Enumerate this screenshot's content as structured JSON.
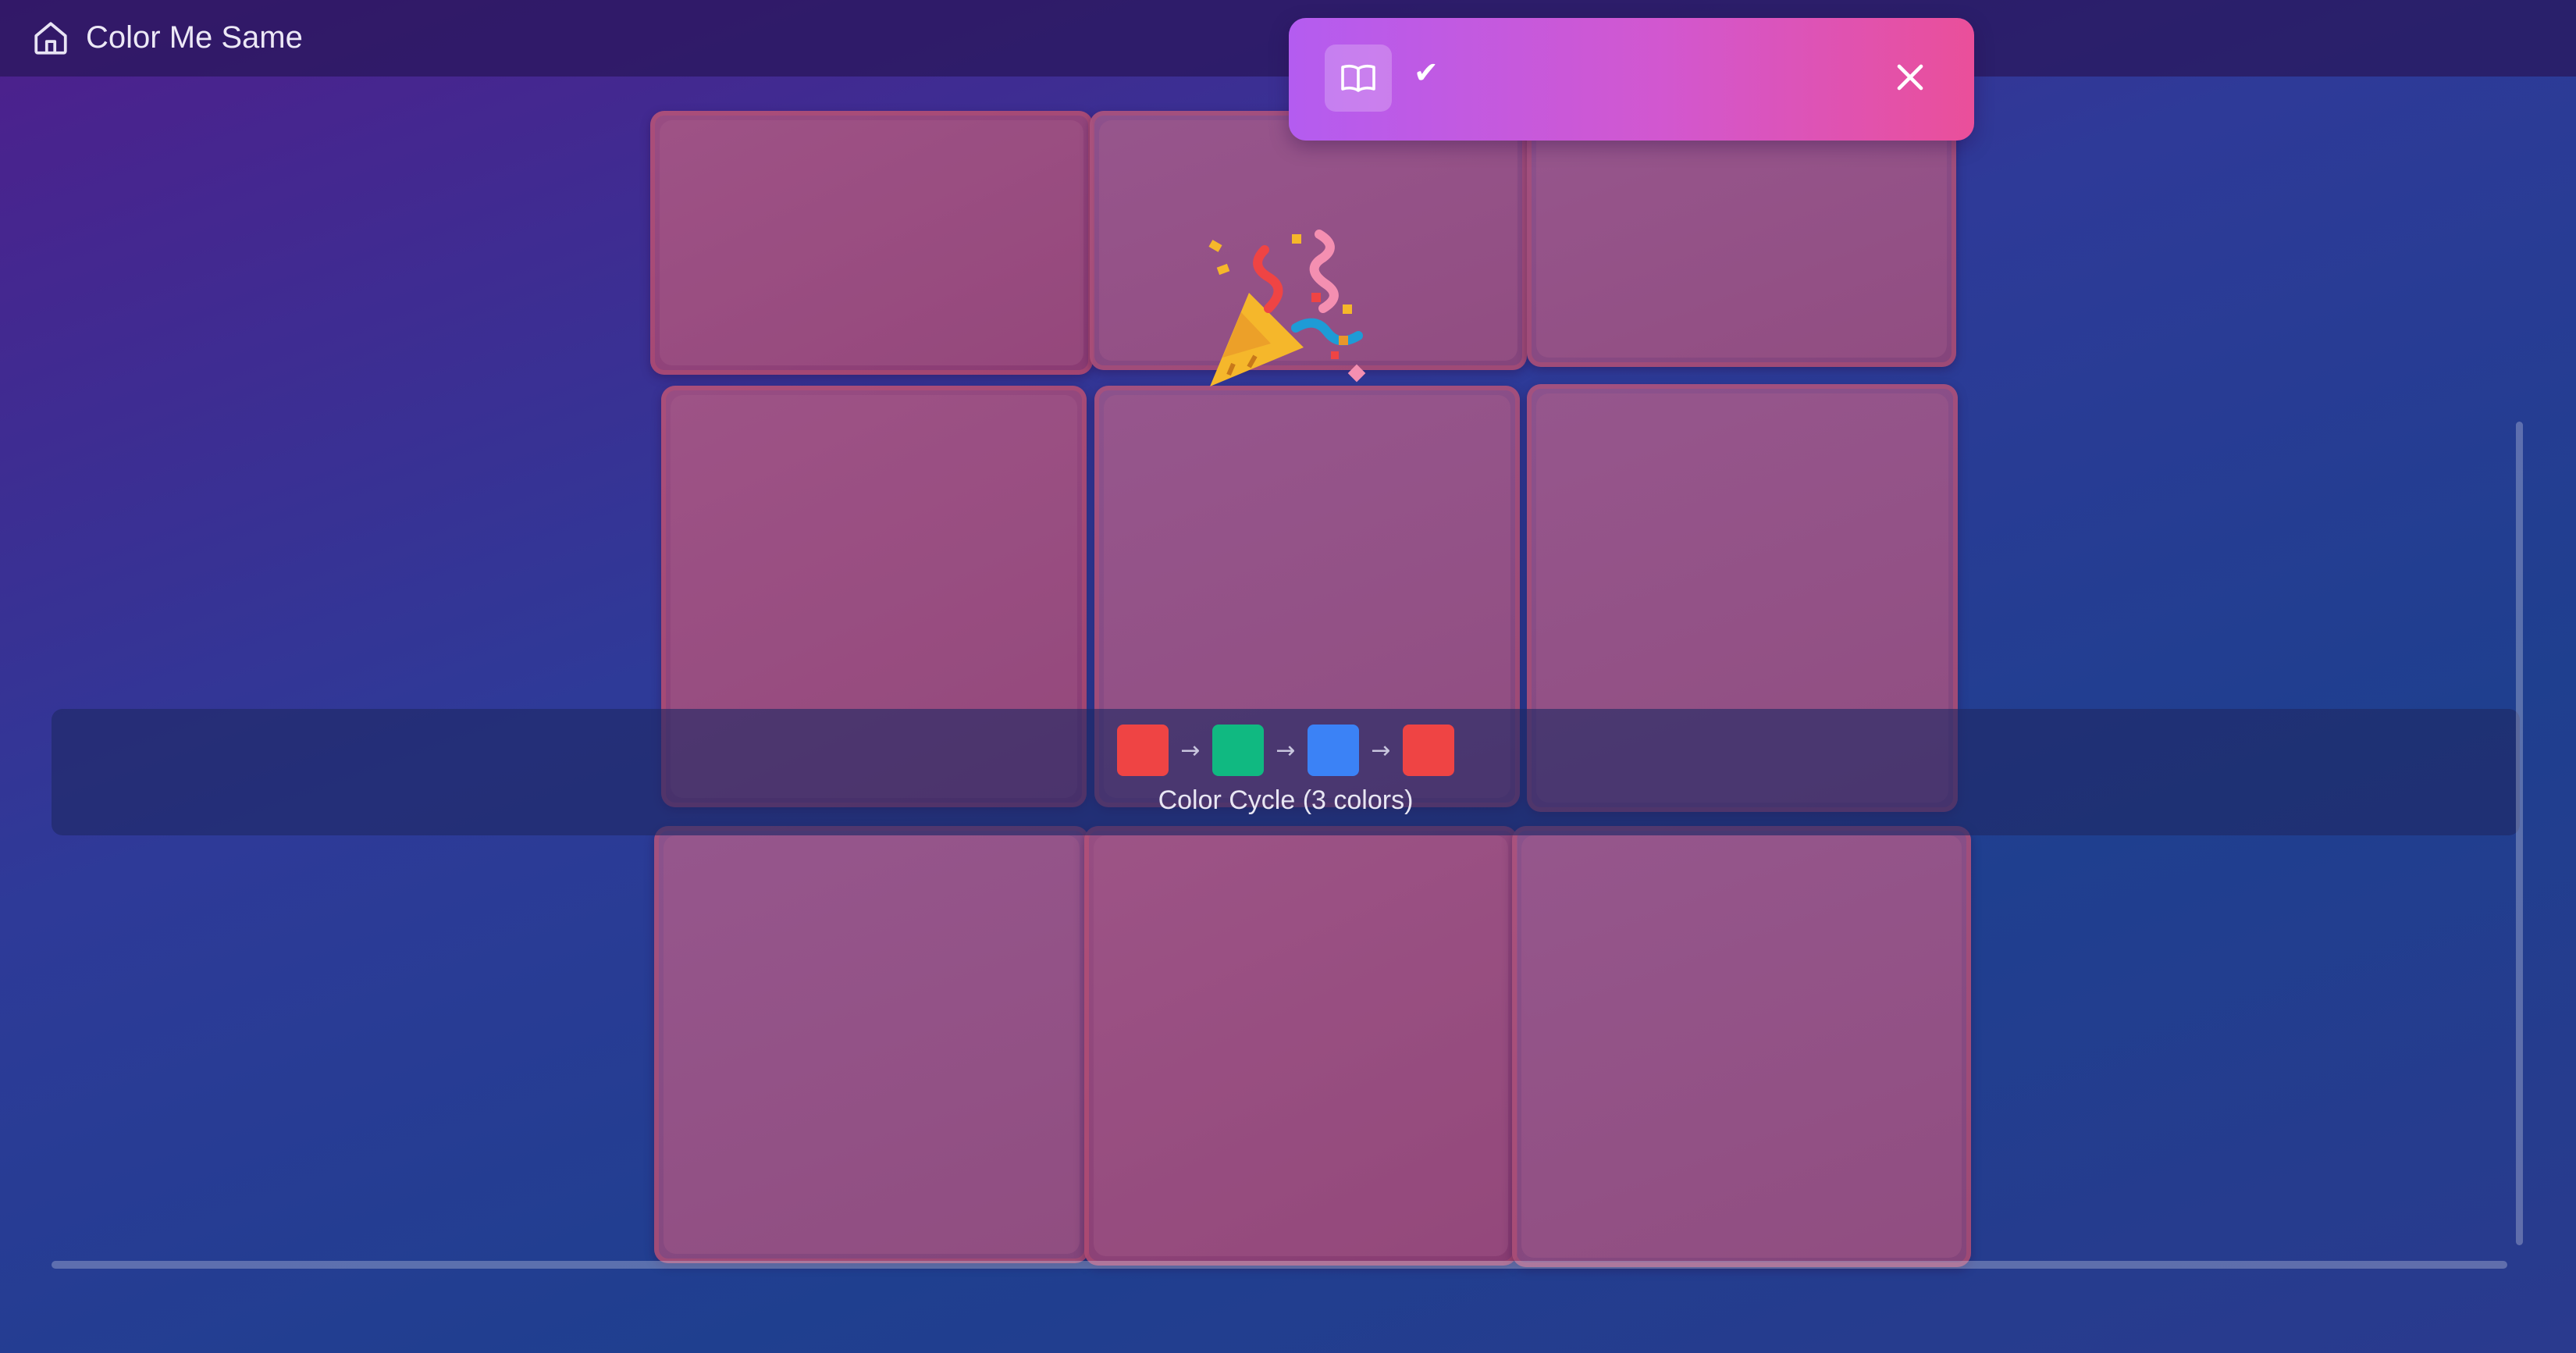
{
  "app": {
    "title": "Color Me Same",
    "home_icon": "home-icon"
  },
  "toast": {
    "icon": "book-open-icon",
    "status_icon": "check-icon",
    "check_glyph": "✔",
    "close_icon": "close-icon",
    "gradient": [
      "#b45cf0",
      "#ea4f9a"
    ]
  },
  "celebration": {
    "icon": "party-popper-icon"
  },
  "board": {
    "rows": 3,
    "cols": 3,
    "tile_color": "#9a4f7e"
  },
  "legend": {
    "caption": "Color Cycle (3 colors)",
    "arrow_glyph": "→",
    "colors": [
      "#ef4444",
      "#10b981",
      "#3b82f6",
      "#ef4444"
    ]
  }
}
